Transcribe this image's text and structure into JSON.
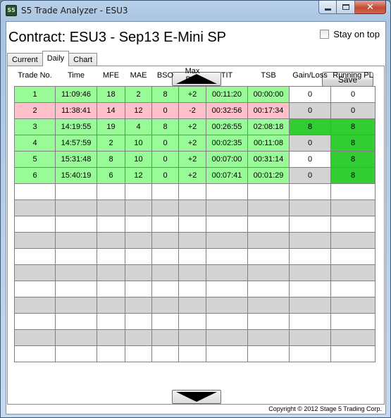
{
  "window": {
    "app_icon_text": "S5",
    "title": "S5 Trade Analyzer - ESU3",
    "close_glyph": "✕"
  },
  "header": {
    "contract": "Contract: ESU3 - Sep13 E-Mini SP",
    "stay_on_top_label": "Stay on top",
    "stay_on_top_checked": false
  },
  "tabs": [
    {
      "label": "Current",
      "active": false
    },
    {
      "label": "Daily",
      "active": true
    },
    {
      "label": "Chart",
      "active": false
    }
  ],
  "toolbar": {
    "save_label": "Save"
  },
  "table": {
    "columns": [
      "Trade No.",
      "Time",
      "MFE",
      "MAE",
      "BSO",
      "Max Pos",
      "TIT",
      "TSB",
      "Gain/Loss",
      "Running PL"
    ],
    "rows": [
      {
        "cells": [
          "1",
          "11:09:46",
          "18",
          "2",
          "8",
          "+2",
          "00:11:20",
          "00:00:00",
          "0",
          "0"
        ],
        "colors": [
          "green",
          "green",
          "green",
          "green",
          "green",
          "green",
          "green",
          "green",
          "white",
          "white"
        ]
      },
      {
        "cells": [
          "2",
          "11:38:41",
          "14",
          "12",
          "0",
          "-2",
          "00:32:56",
          "00:17:34",
          "0",
          "0"
        ],
        "colors": [
          "pink",
          "pink",
          "pink",
          "pink",
          "pink",
          "pink",
          "pink",
          "pink",
          "gray",
          "gray"
        ]
      },
      {
        "cells": [
          "3",
          "14:19:55",
          "19",
          "4",
          "8",
          "+2",
          "00:26:55",
          "02:08:18",
          "8",
          "8"
        ],
        "colors": [
          "green",
          "green",
          "green",
          "green",
          "green",
          "green",
          "green",
          "green",
          "dark",
          "dark"
        ]
      },
      {
        "cells": [
          "4",
          "14:57:59",
          "2",
          "10",
          "0",
          "+2",
          "00:02:35",
          "00:11:08",
          "0",
          "8"
        ],
        "colors": [
          "green",
          "green",
          "green",
          "green",
          "green",
          "green",
          "green",
          "green",
          "gray",
          "dark"
        ]
      },
      {
        "cells": [
          "5",
          "15:31:48",
          "8",
          "10",
          "0",
          "+2",
          "00:07:00",
          "00:31:14",
          "0",
          "8"
        ],
        "colors": [
          "green",
          "green",
          "green",
          "green",
          "green",
          "green",
          "green",
          "green",
          "white",
          "dark"
        ]
      },
      {
        "cells": [
          "6",
          "15:40:19",
          "6",
          "12",
          "0",
          "+2",
          "00:07:41",
          "00:01:29",
          "0",
          "8"
        ],
        "colors": [
          "green",
          "green",
          "green",
          "green",
          "green",
          "green",
          "green",
          "green",
          "gray",
          "dark"
        ]
      }
    ],
    "empty_rows": 11
  },
  "footer": {
    "copyright": "Copyright © 2012 Stage 5 Trading Corp."
  }
}
